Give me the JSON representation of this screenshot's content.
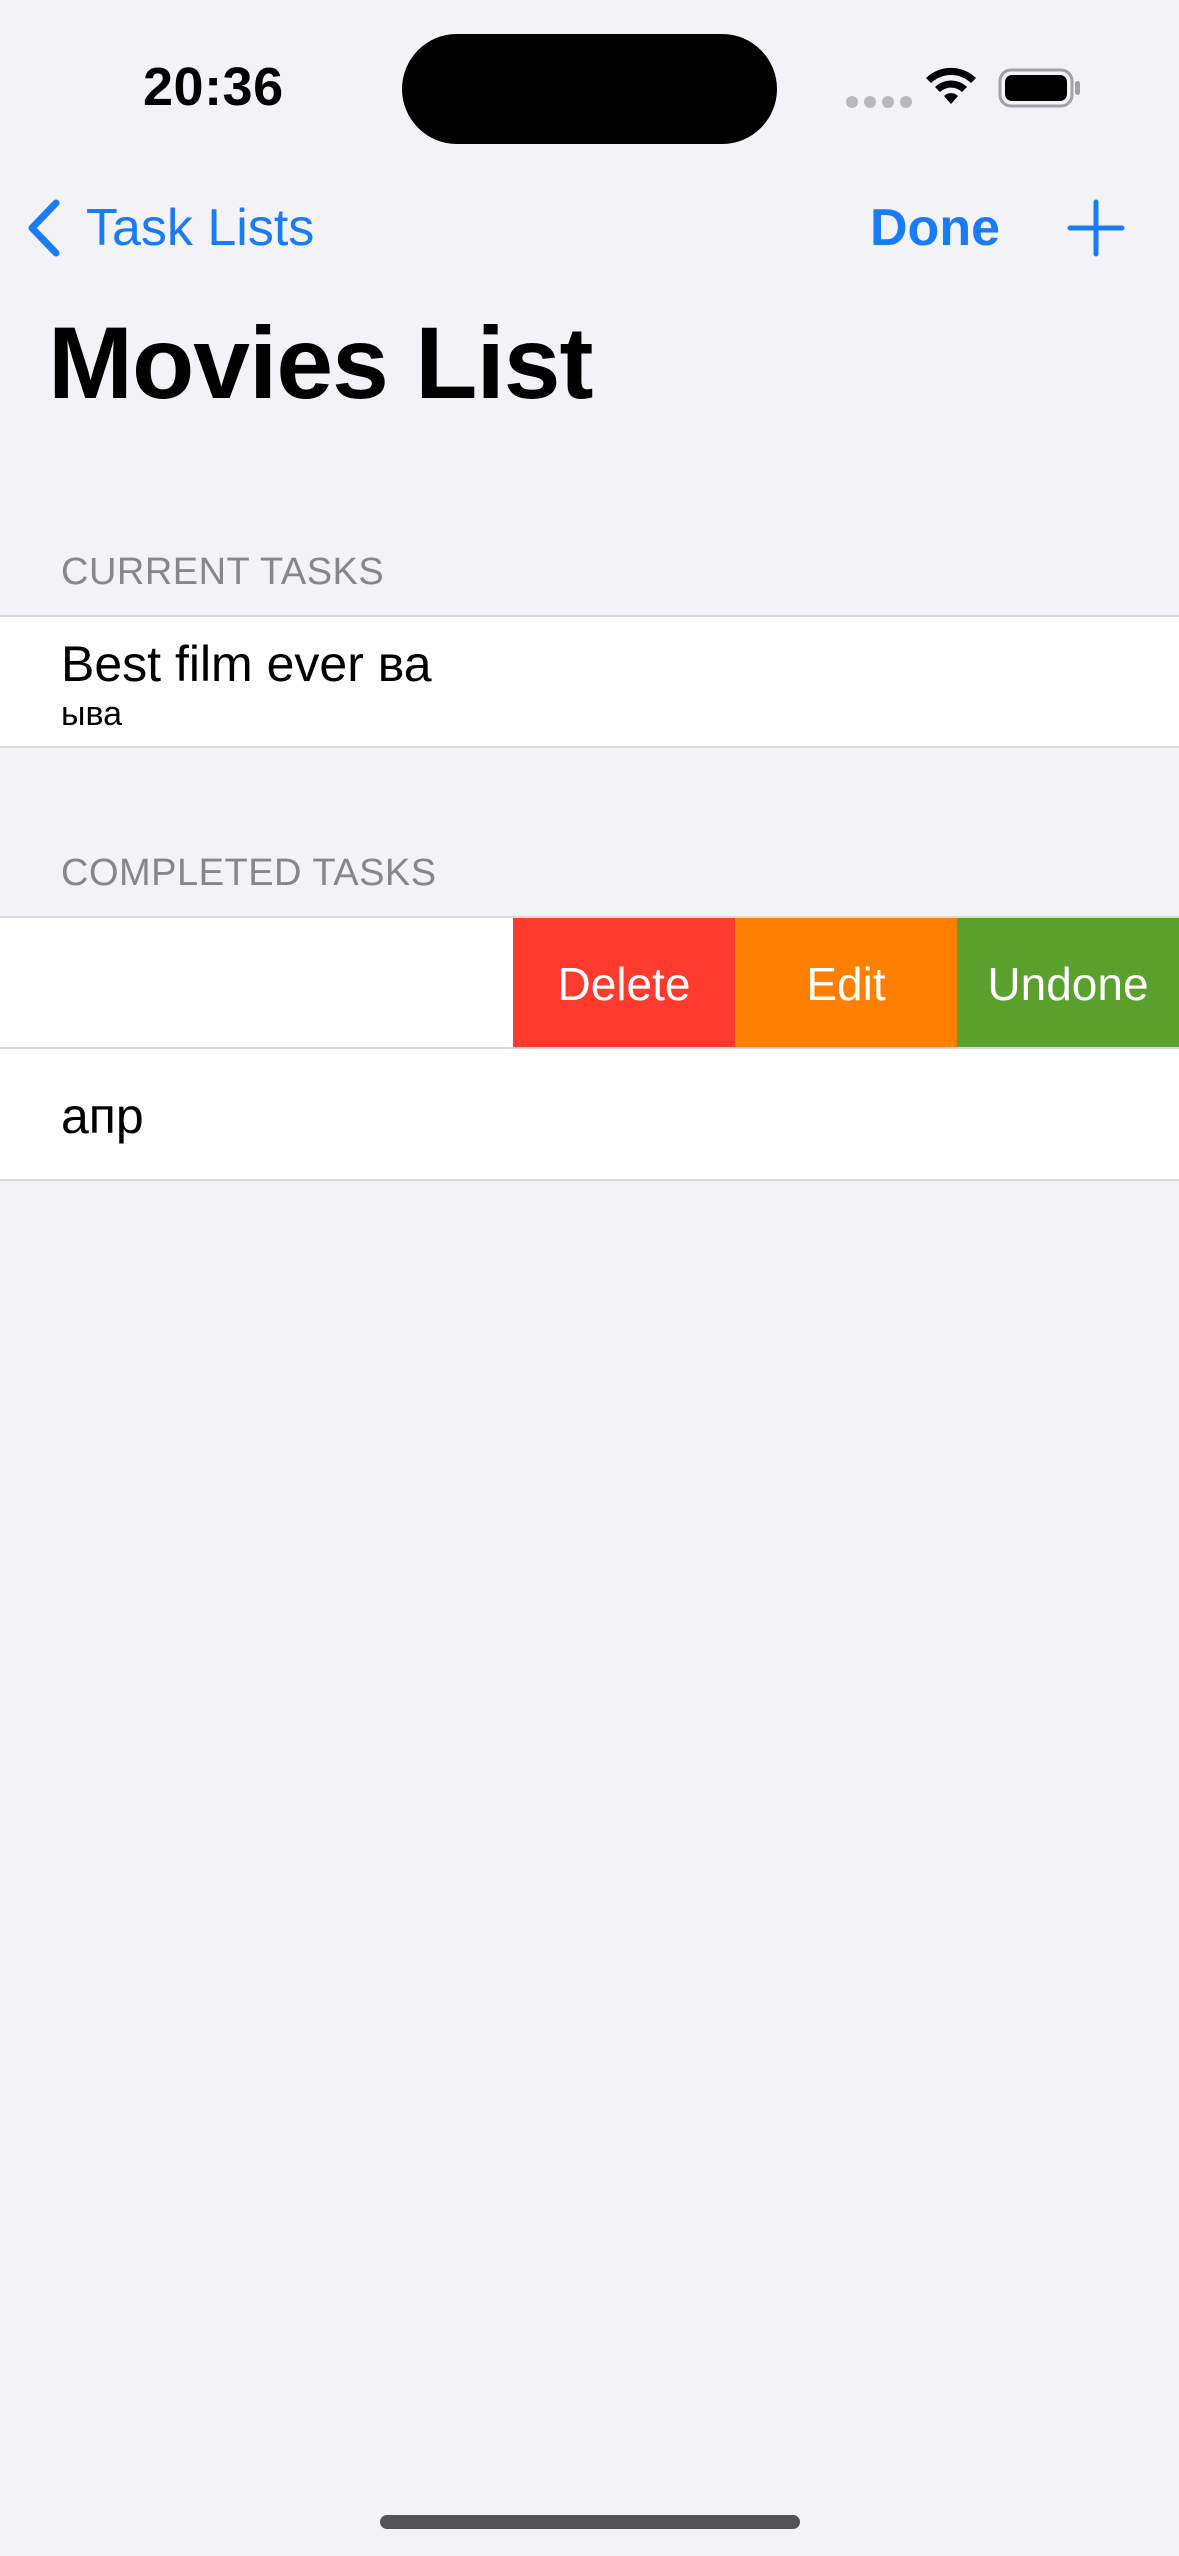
{
  "status_bar": {
    "time": "20:36"
  },
  "nav": {
    "back_label": "Task Lists",
    "done_label": "Done",
    "accent_color": "#1a7cf5"
  },
  "page": {
    "title": "Movies List"
  },
  "sections": {
    "current": {
      "header": "CURRENT TASKS",
      "items": [
        {
          "title": "Best film ever ва",
          "subtitle": "ыва"
        }
      ]
    },
    "completed": {
      "header": "COMPLETED TASKS",
      "swiped_actions": [
        {
          "label": "Delete",
          "color": "#ff3b30"
        },
        {
          "label": "Edit",
          "color": "#ff7f00"
        },
        {
          "label": "Undone",
          "color": "#5aa02c"
        }
      ],
      "items": [
        {
          "title": "апр"
        }
      ]
    }
  },
  "icons": {
    "back": "chevron-left-icon",
    "add": "plus-icon",
    "wifi": "wifi-icon",
    "battery": "battery-icon"
  }
}
